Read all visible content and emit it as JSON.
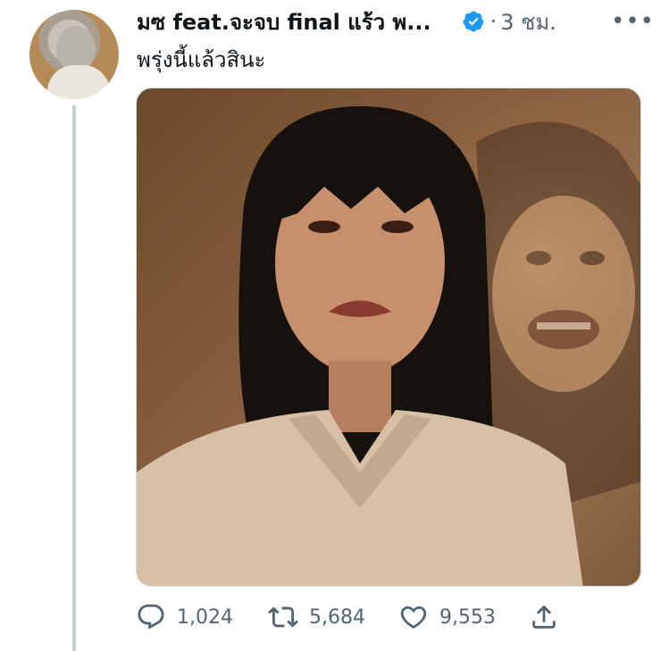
{
  "tweet": {
    "author_name": "มซ feat.จะจบ final แร้ว พ...",
    "separator": "·",
    "time": "3 ชม.",
    "more": "•••",
    "text": "พรุ่งนี้แล้วสินะ"
  },
  "actions": {
    "reply_count": "1,024",
    "retweet_count": "5,684",
    "like_count": "9,553"
  },
  "icons": {
    "verified": "verified-badge-icon",
    "reply": "reply-icon",
    "retweet": "retweet-icon",
    "like": "heart-icon",
    "share": "share-icon",
    "more": "more-icon"
  },
  "colors": {
    "verified": "#1d9bf0",
    "muted": "#536471",
    "thread_line": "#c4cfd6"
  }
}
